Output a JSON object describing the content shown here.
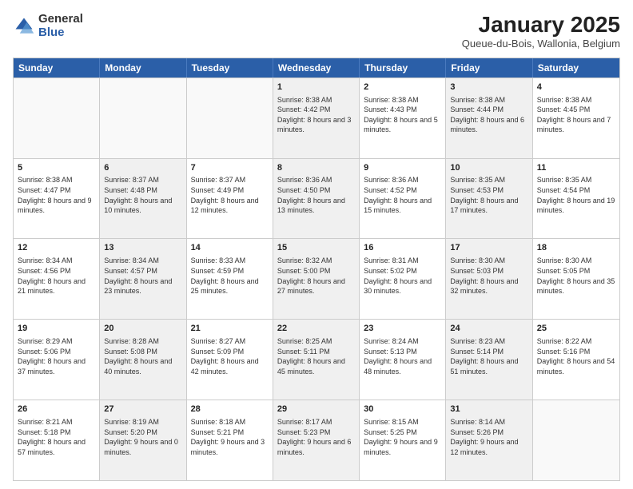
{
  "logo": {
    "general": "General",
    "blue": "Blue"
  },
  "title": "January 2025",
  "subtitle": "Queue-du-Bois, Wallonia, Belgium",
  "days": [
    "Sunday",
    "Monday",
    "Tuesday",
    "Wednesday",
    "Thursday",
    "Friday",
    "Saturday"
  ],
  "weeks": [
    [
      {
        "day": "",
        "sunrise": "",
        "sunset": "",
        "daylight": "",
        "shaded": false,
        "empty": true
      },
      {
        "day": "",
        "sunrise": "",
        "sunset": "",
        "daylight": "",
        "shaded": false,
        "empty": true
      },
      {
        "day": "",
        "sunrise": "",
        "sunset": "",
        "daylight": "",
        "shaded": false,
        "empty": true
      },
      {
        "day": "1",
        "sunrise": "Sunrise: 8:38 AM",
        "sunset": "Sunset: 4:42 PM",
        "daylight": "Daylight: 8 hours and 3 minutes.",
        "shaded": true,
        "empty": false
      },
      {
        "day": "2",
        "sunrise": "Sunrise: 8:38 AM",
        "sunset": "Sunset: 4:43 PM",
        "daylight": "Daylight: 8 hours and 5 minutes.",
        "shaded": false,
        "empty": false
      },
      {
        "day": "3",
        "sunrise": "Sunrise: 8:38 AM",
        "sunset": "Sunset: 4:44 PM",
        "daylight": "Daylight: 8 hours and 6 minutes.",
        "shaded": true,
        "empty": false
      },
      {
        "day": "4",
        "sunrise": "Sunrise: 8:38 AM",
        "sunset": "Sunset: 4:45 PM",
        "daylight": "Daylight: 8 hours and 7 minutes.",
        "shaded": false,
        "empty": false
      }
    ],
    [
      {
        "day": "5",
        "sunrise": "Sunrise: 8:38 AM",
        "sunset": "Sunset: 4:47 PM",
        "daylight": "Daylight: 8 hours and 9 minutes.",
        "shaded": false,
        "empty": false
      },
      {
        "day": "6",
        "sunrise": "Sunrise: 8:37 AM",
        "sunset": "Sunset: 4:48 PM",
        "daylight": "Daylight: 8 hours and 10 minutes.",
        "shaded": true,
        "empty": false
      },
      {
        "day": "7",
        "sunrise": "Sunrise: 8:37 AM",
        "sunset": "Sunset: 4:49 PM",
        "daylight": "Daylight: 8 hours and 12 minutes.",
        "shaded": false,
        "empty": false
      },
      {
        "day": "8",
        "sunrise": "Sunrise: 8:36 AM",
        "sunset": "Sunset: 4:50 PM",
        "daylight": "Daylight: 8 hours and 13 minutes.",
        "shaded": true,
        "empty": false
      },
      {
        "day": "9",
        "sunrise": "Sunrise: 8:36 AM",
        "sunset": "Sunset: 4:52 PM",
        "daylight": "Daylight: 8 hours and 15 minutes.",
        "shaded": false,
        "empty": false
      },
      {
        "day": "10",
        "sunrise": "Sunrise: 8:35 AM",
        "sunset": "Sunset: 4:53 PM",
        "daylight": "Daylight: 8 hours and 17 minutes.",
        "shaded": true,
        "empty": false
      },
      {
        "day": "11",
        "sunrise": "Sunrise: 8:35 AM",
        "sunset": "Sunset: 4:54 PM",
        "daylight": "Daylight: 8 hours and 19 minutes.",
        "shaded": false,
        "empty": false
      }
    ],
    [
      {
        "day": "12",
        "sunrise": "Sunrise: 8:34 AM",
        "sunset": "Sunset: 4:56 PM",
        "daylight": "Daylight: 8 hours and 21 minutes.",
        "shaded": false,
        "empty": false
      },
      {
        "day": "13",
        "sunrise": "Sunrise: 8:34 AM",
        "sunset": "Sunset: 4:57 PM",
        "daylight": "Daylight: 8 hours and 23 minutes.",
        "shaded": true,
        "empty": false
      },
      {
        "day": "14",
        "sunrise": "Sunrise: 8:33 AM",
        "sunset": "Sunset: 4:59 PM",
        "daylight": "Daylight: 8 hours and 25 minutes.",
        "shaded": false,
        "empty": false
      },
      {
        "day": "15",
        "sunrise": "Sunrise: 8:32 AM",
        "sunset": "Sunset: 5:00 PM",
        "daylight": "Daylight: 8 hours and 27 minutes.",
        "shaded": true,
        "empty": false
      },
      {
        "day": "16",
        "sunrise": "Sunrise: 8:31 AM",
        "sunset": "Sunset: 5:02 PM",
        "daylight": "Daylight: 8 hours and 30 minutes.",
        "shaded": false,
        "empty": false
      },
      {
        "day": "17",
        "sunrise": "Sunrise: 8:30 AM",
        "sunset": "Sunset: 5:03 PM",
        "daylight": "Daylight: 8 hours and 32 minutes.",
        "shaded": true,
        "empty": false
      },
      {
        "day": "18",
        "sunrise": "Sunrise: 8:30 AM",
        "sunset": "Sunset: 5:05 PM",
        "daylight": "Daylight: 8 hours and 35 minutes.",
        "shaded": false,
        "empty": false
      }
    ],
    [
      {
        "day": "19",
        "sunrise": "Sunrise: 8:29 AM",
        "sunset": "Sunset: 5:06 PM",
        "daylight": "Daylight: 8 hours and 37 minutes.",
        "shaded": false,
        "empty": false
      },
      {
        "day": "20",
        "sunrise": "Sunrise: 8:28 AM",
        "sunset": "Sunset: 5:08 PM",
        "daylight": "Daylight: 8 hours and 40 minutes.",
        "shaded": true,
        "empty": false
      },
      {
        "day": "21",
        "sunrise": "Sunrise: 8:27 AM",
        "sunset": "Sunset: 5:09 PM",
        "daylight": "Daylight: 8 hours and 42 minutes.",
        "shaded": false,
        "empty": false
      },
      {
        "day": "22",
        "sunrise": "Sunrise: 8:25 AM",
        "sunset": "Sunset: 5:11 PM",
        "daylight": "Daylight: 8 hours and 45 minutes.",
        "shaded": true,
        "empty": false
      },
      {
        "day": "23",
        "sunrise": "Sunrise: 8:24 AM",
        "sunset": "Sunset: 5:13 PM",
        "daylight": "Daylight: 8 hours and 48 minutes.",
        "shaded": false,
        "empty": false
      },
      {
        "day": "24",
        "sunrise": "Sunrise: 8:23 AM",
        "sunset": "Sunset: 5:14 PM",
        "daylight": "Daylight: 8 hours and 51 minutes.",
        "shaded": true,
        "empty": false
      },
      {
        "day": "25",
        "sunrise": "Sunrise: 8:22 AM",
        "sunset": "Sunset: 5:16 PM",
        "daylight": "Daylight: 8 hours and 54 minutes.",
        "shaded": false,
        "empty": false
      }
    ],
    [
      {
        "day": "26",
        "sunrise": "Sunrise: 8:21 AM",
        "sunset": "Sunset: 5:18 PM",
        "daylight": "Daylight: 8 hours and 57 minutes.",
        "shaded": false,
        "empty": false
      },
      {
        "day": "27",
        "sunrise": "Sunrise: 8:19 AM",
        "sunset": "Sunset: 5:20 PM",
        "daylight": "Daylight: 9 hours and 0 minutes.",
        "shaded": true,
        "empty": false
      },
      {
        "day": "28",
        "sunrise": "Sunrise: 8:18 AM",
        "sunset": "Sunset: 5:21 PM",
        "daylight": "Daylight: 9 hours and 3 minutes.",
        "shaded": false,
        "empty": false
      },
      {
        "day": "29",
        "sunrise": "Sunrise: 8:17 AM",
        "sunset": "Sunset: 5:23 PM",
        "daylight": "Daylight: 9 hours and 6 minutes.",
        "shaded": true,
        "empty": false
      },
      {
        "day": "30",
        "sunrise": "Sunrise: 8:15 AM",
        "sunset": "Sunset: 5:25 PM",
        "daylight": "Daylight: 9 hours and 9 minutes.",
        "shaded": false,
        "empty": false
      },
      {
        "day": "31",
        "sunrise": "Sunrise: 8:14 AM",
        "sunset": "Sunset: 5:26 PM",
        "daylight": "Daylight: 9 hours and 12 minutes.",
        "shaded": true,
        "empty": false
      },
      {
        "day": "",
        "sunrise": "",
        "sunset": "",
        "daylight": "",
        "shaded": false,
        "empty": true
      }
    ]
  ]
}
